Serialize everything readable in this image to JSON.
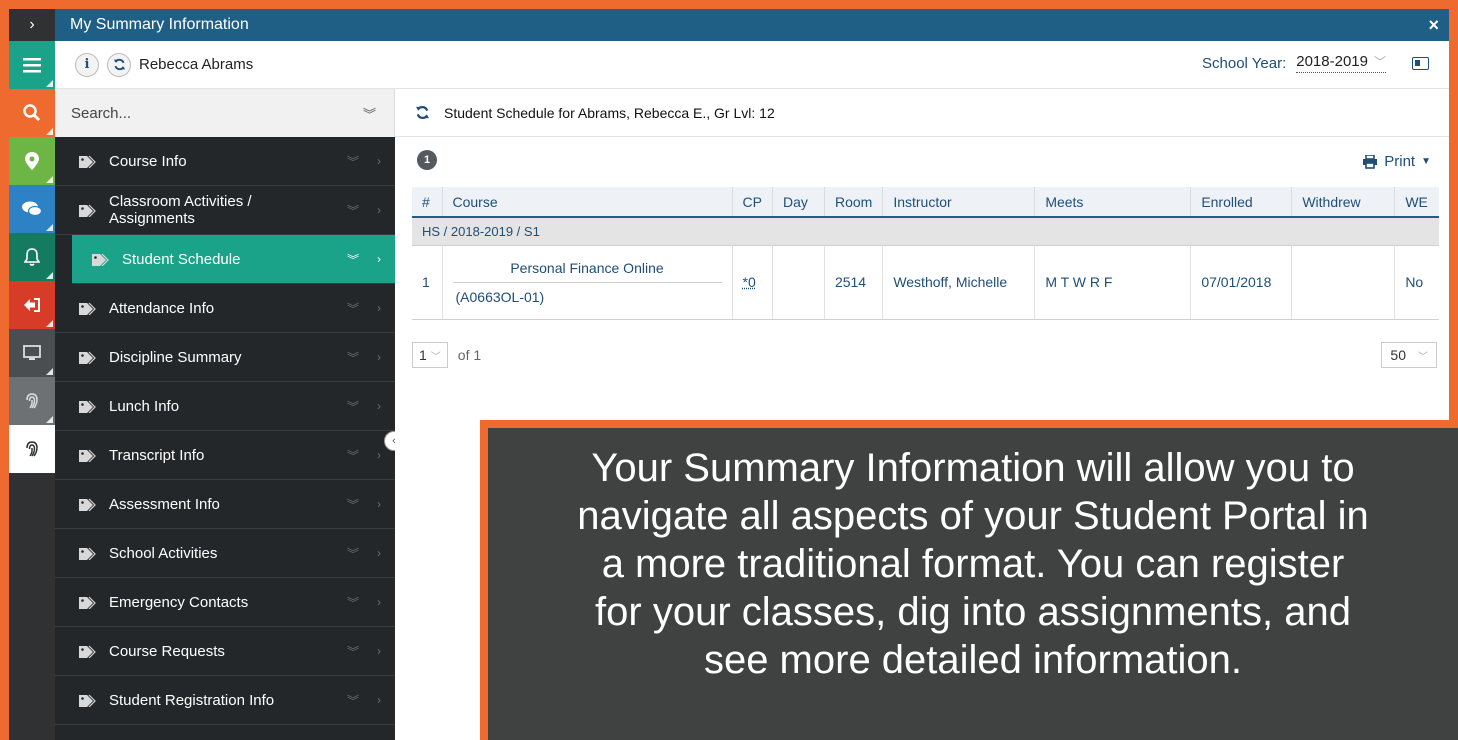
{
  "topbar": {
    "title": "My Summary Information",
    "close": "×",
    "expand": "›"
  },
  "header": {
    "user_name": "Rebecca Abrams",
    "info_icon": "i",
    "school_year_label": "School Year:",
    "school_year_value": "2018-2019"
  },
  "rail": [
    {
      "icon": "hamburger-icon",
      "color": "#1aa389"
    },
    {
      "icon": "search-icon",
      "color": "#ee6a2f"
    },
    {
      "icon": "map-pin-icon",
      "color": "#6db544"
    },
    {
      "icon": "chat-icon",
      "color": "#2d82c6"
    },
    {
      "icon": "bell-icon",
      "color": "#147a60"
    },
    {
      "icon": "sign-out-icon",
      "color": "#d63c28"
    },
    {
      "icon": "monitor-icon",
      "color": "#4b4e51"
    },
    {
      "icon": "fingerprint-icon",
      "color": "#6e7173"
    },
    {
      "icon": "fingerprint-icon",
      "color": "#ffffff"
    }
  ],
  "menu": {
    "search_placeholder": "Search...",
    "items": [
      {
        "label": "Course Info",
        "active": false
      },
      {
        "label": "Classroom Activities / Assignments",
        "active": false
      },
      {
        "label": "Student Schedule",
        "active": true
      },
      {
        "label": "Attendance Info",
        "active": false
      },
      {
        "label": "Discipline Summary",
        "active": false
      },
      {
        "label": "Lunch Info",
        "active": false
      },
      {
        "label": "Transcript Info",
        "active": false
      },
      {
        "label": "Assessment Info",
        "active": false
      },
      {
        "label": "School Activities",
        "active": false
      },
      {
        "label": "Emergency Contacts",
        "active": false
      },
      {
        "label": "Course Requests",
        "active": false
      },
      {
        "label": "Student Registration Info",
        "active": false
      }
    ]
  },
  "schedule": {
    "title": "Student Schedule for Abrams, Rebecca E., Gr Lvl: 12",
    "badge": "1",
    "print_label": "Print",
    "columns": [
      "#",
      "Course",
      "CP",
      "Day",
      "Room",
      "Instructor",
      "Meets",
      "Enrolled",
      "Withdrew",
      "WE"
    ],
    "group": "HS / 2018-2019 / S1",
    "row": {
      "num": "1",
      "course_name": "Personal Finance Online",
      "course_code": "(A0663OL-01)",
      "cp": "*0",
      "day": "",
      "room": "2514",
      "instructor": "Westhoff, Michelle",
      "meets": "M T W R F",
      "enrolled": "07/01/2018",
      "withdrew": "",
      "we": "No"
    },
    "pager": {
      "page": "1",
      "of": "of 1",
      "per_page": "50"
    }
  },
  "callout": {
    "lines": [
      "Your Summary Information will allow you to",
      "navigate all aspects of your Student Portal in",
      "a more traditional format.  You can register",
      "for your classes, dig into assignments, and",
      "see more detailed information."
    ]
  }
}
